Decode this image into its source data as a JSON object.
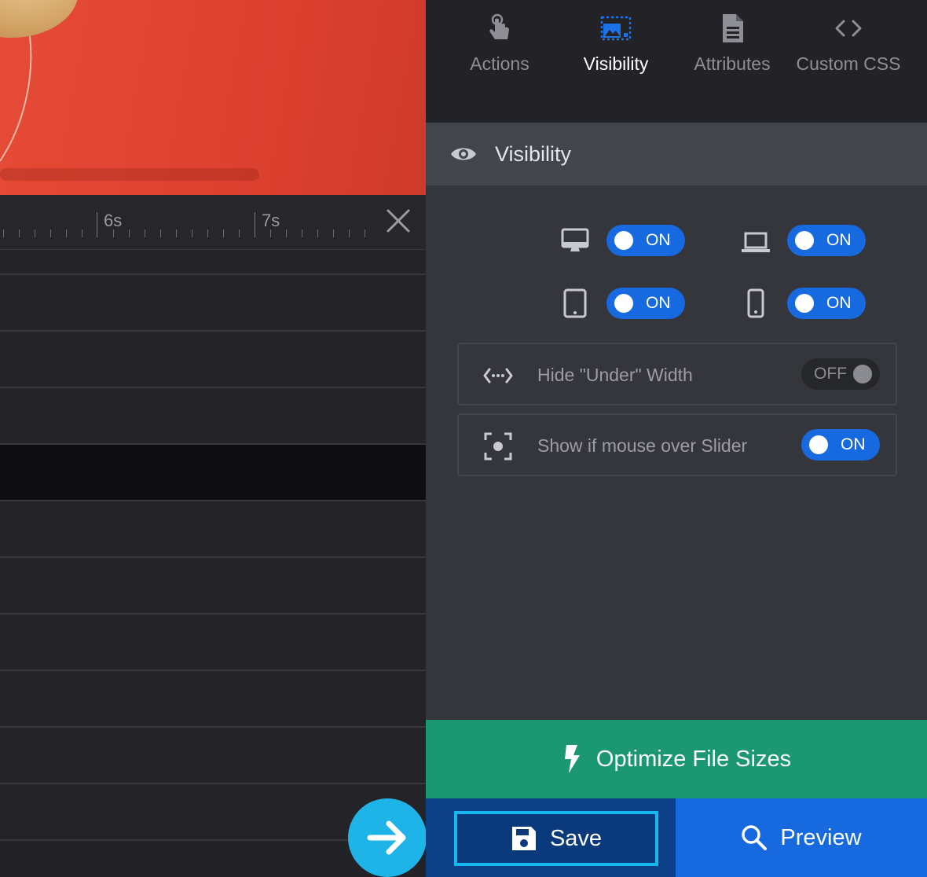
{
  "ruler": {
    "labels": [
      "6s",
      "7s"
    ]
  },
  "tabs": [
    {
      "id": "actions",
      "label": "Actions",
      "icon": "touch-icon"
    },
    {
      "id": "visibility",
      "label": "Visibility",
      "icon": "image-select-icon"
    },
    {
      "id": "attributes",
      "label": "Attributes",
      "icon": "document-icon"
    },
    {
      "id": "custom-css",
      "label": "Custom CSS",
      "icon": "code-icon"
    }
  ],
  "section": {
    "title": "Visibility",
    "icon": "eye-icon"
  },
  "devices": {
    "desktop": {
      "icon": "desktop-icon",
      "state": "ON"
    },
    "laptop": {
      "icon": "laptop-icon",
      "state": "ON"
    },
    "tablet": {
      "icon": "tablet-icon",
      "state": "ON"
    },
    "mobile": {
      "icon": "mobile-icon",
      "state": "ON"
    }
  },
  "options": {
    "hide_under_width": {
      "label": "Hide \"Under\" Width",
      "state": "OFF",
      "icon": "width-arrows-icon"
    },
    "show_mouse_over": {
      "label": "Show if mouse over Slider",
      "state": "ON",
      "icon": "focus-icon"
    }
  },
  "footer": {
    "optimize_label": "Optimize File Sizes",
    "save_label": "Save",
    "preview_label": "Preview"
  },
  "colors": {
    "accent_blue": "#1769e0",
    "optimize_green": "#1b9771",
    "save_highlight": "#17b8ef",
    "canvas_red": "#e04533"
  }
}
